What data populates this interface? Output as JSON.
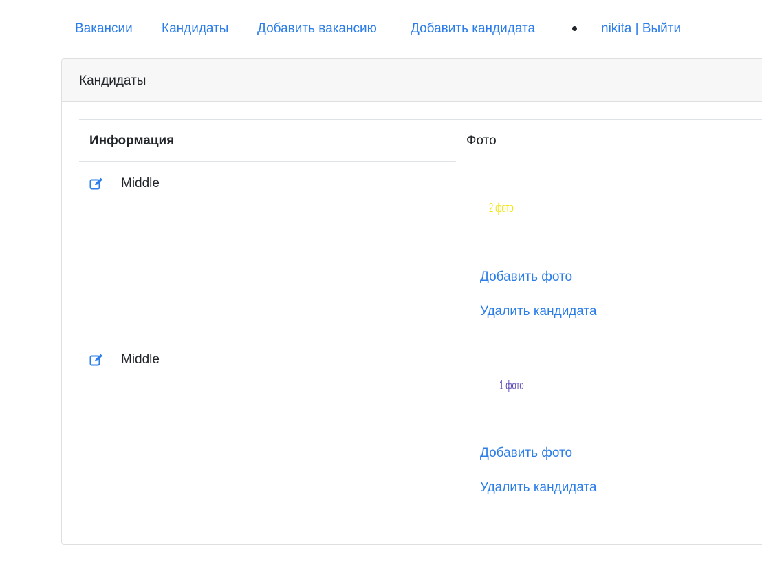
{
  "nav": {
    "vacancies": "Вакансии",
    "candidates": "Кандидаты",
    "add_vacancy": "Добавить вакансию",
    "add_candidate": "Добавить кандидата",
    "user_logout": "nikita | Выйти"
  },
  "card": {
    "title": "Кандидаты"
  },
  "table": {
    "headers": {
      "info": "Информация",
      "photo": "Фото"
    },
    "rows": [
      {
        "name": "Middle",
        "photo_text": "2 фото",
        "add_photo": "Добавить фото",
        "delete": "Удалить кандидата"
      },
      {
        "name": "Middle",
        "photo_text": "1 фото",
        "add_photo": "Добавить фото",
        "delete": "Удалить кандидата"
      }
    ]
  },
  "colors": {
    "link": "#2b7de9",
    "text": "#212529",
    "header_bg": "#f7f7f7",
    "photo_1": "#f2e600",
    "photo_2": "#5b4bb7"
  },
  "icons": {
    "edit": "edit-icon"
  }
}
